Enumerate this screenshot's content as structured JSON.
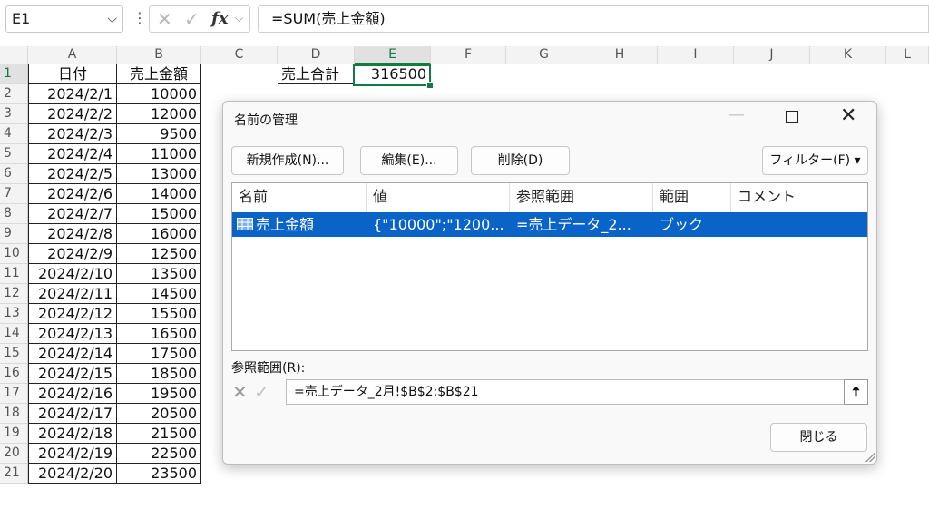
{
  "formula_bar": {
    "name_box": "E1",
    "formula": "=SUM(売上金額)",
    "fx_label": "fx",
    "cancel_icon": "close-icon",
    "enter_icon": "check-icon"
  },
  "columns": [
    "A",
    "B",
    "C",
    "D",
    "E",
    "F",
    "G",
    "H",
    "I",
    "J",
    "K",
    "L"
  ],
  "rows": [
    "1",
    "2",
    "3",
    "4",
    "5",
    "6",
    "7",
    "8",
    "9",
    "10",
    "11",
    "12",
    "13",
    "14",
    "15",
    "16",
    "17",
    "18",
    "19",
    "20",
    "21"
  ],
  "sheet": {
    "header_date": "日付",
    "header_amount": "売上金額",
    "total_label": "売上合計",
    "total_value": "316500",
    "dates": [
      "2024/2/1",
      "2024/2/2",
      "2024/2/3",
      "2024/2/4",
      "2024/2/5",
      "2024/2/6",
      "2024/2/7",
      "2024/2/8",
      "2024/2/9",
      "2024/2/10",
      "2024/2/11",
      "2024/2/12",
      "2024/2/13",
      "2024/2/14",
      "2024/2/15",
      "2024/2/16",
      "2024/2/17",
      "2024/2/18",
      "2024/2/19",
      "2024/2/20"
    ],
    "amounts": [
      "10000",
      "12000",
      "9500",
      "11000",
      "13000",
      "14000",
      "15000",
      "16000",
      "12500",
      "13500",
      "14500",
      "15500",
      "16500",
      "17500",
      "18500",
      "19500",
      "20500",
      "21500",
      "22500",
      "23500"
    ]
  },
  "dialog": {
    "title": "名前の管理",
    "new_button": "新規作成(N)...",
    "edit_button": "編集(E)...",
    "delete_button": "削除(D)",
    "filter_button": "フィルター(F) ▾",
    "columns": {
      "name": "名前",
      "value": "値",
      "refers_to": "参照範囲",
      "scope": "範囲",
      "comment": "コメント"
    },
    "row": {
      "name": "売上金額",
      "value": "{\"10000\";\"1200...",
      "refers_to": "=売上データ_2...",
      "scope": "ブック",
      "comment": ""
    },
    "ref_label": "参照範囲(R):",
    "ref_value": "=売上データ_2月!$B$2:$B$21",
    "close_button": "閉じる"
  },
  "colors": {
    "selection": "#0a64c8",
    "accent": "#107c41"
  }
}
